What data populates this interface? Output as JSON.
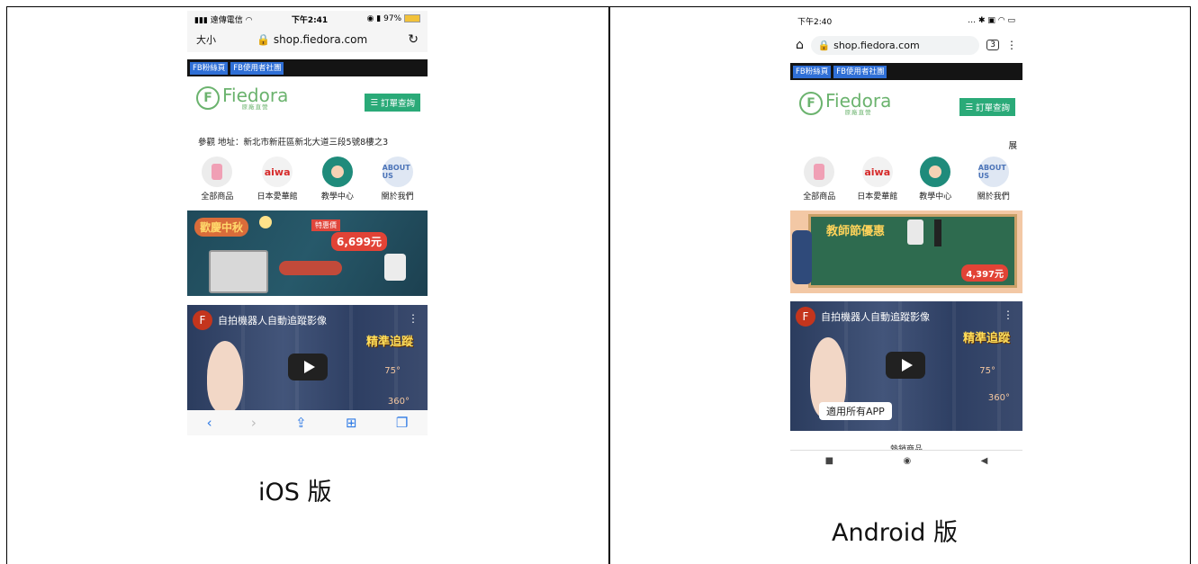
{
  "captions": {
    "ios": "iOS 版",
    "android": "Android 版"
  },
  "ios": {
    "status": {
      "carrier": "遠傳電信",
      "time": "下午2:41",
      "battery": "97%"
    },
    "url_bar": {
      "text_size": "大小",
      "url": "shop.fiedora.com"
    },
    "fb_buttons": [
      "FB粉絲頁",
      "FB使用者社團"
    ],
    "logo": {
      "name": "Fiedora",
      "sub": "原廠直營"
    },
    "order_button": "訂單查詢",
    "marquee": "參觀 地址：新北市新莊區新北大道三段5號8樓之3",
    "categories": [
      "全部商品",
      "日本愛華館",
      "教學中心",
      "關於我們"
    ],
    "banner": {
      "title": "歡慶中秋",
      "badge": "特惠價",
      "price": "6,699元"
    },
    "video": {
      "title": "自拍機器人自動追蹤影像",
      "tag": "精準追蹤",
      "deg1": "75°",
      "deg2": "360°"
    }
  },
  "android": {
    "status": {
      "time": "下午2:40"
    },
    "url_bar": {
      "url": "shop.fiedora.com",
      "tabs": "3"
    },
    "fb_buttons": [
      "FB粉絲頁",
      "FB使用者社團"
    ],
    "logo": {
      "name": "Fiedora",
      "sub": "原廠直營"
    },
    "order_button": "訂單查詢",
    "marquee": "展",
    "categories": [
      "全部商品",
      "日本愛華館",
      "教學中心",
      "關於我們"
    ],
    "banner": {
      "title": "教師節優惠",
      "price": "4,397元"
    },
    "video": {
      "title": "自拍機器人自動追蹤影像",
      "tag": "精準追蹤",
      "deg1": "75°",
      "deg2": "360°",
      "app_label": "適用所有APP"
    },
    "below_video": "熱銷商品"
  },
  "colors": {
    "brand_green": "#6bb36e",
    "order_green": "#2aaa78",
    "fb_blue": "#2f6fd6",
    "ios_blue": "#2f7ae5"
  }
}
